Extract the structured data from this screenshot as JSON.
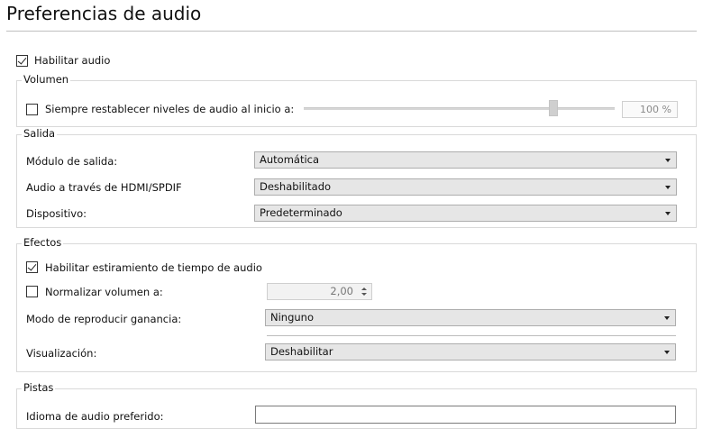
{
  "page": {
    "title": "Preferencias de audio"
  },
  "enable_audio": {
    "label": "Habilitar audio",
    "checked": true
  },
  "volume": {
    "group_label": "Volumen",
    "reset_label": "Siempre restablecer niveles de audio al inicio a:",
    "reset_checked": false,
    "percent_text": "100 %",
    "level": 100
  },
  "output": {
    "group_label": "Salida",
    "module_label": "Módulo de salida:",
    "module_value": "Automática",
    "hdmi_label": "Audio a través de HDMI/SPDIF",
    "hdmi_value": "Deshabilitado",
    "device_label": "Dispositivo:",
    "device_value": "Predeterminado"
  },
  "effects": {
    "group_label": "Efectos",
    "stretch_label": "Habilitar estiramiento de tiempo de audio",
    "stretch_checked": true,
    "normalize_label": "Normalizar volumen a:",
    "normalize_checked": false,
    "normalize_value": "2,00",
    "replay_gain_label": "Modo de reproducir ganancia:",
    "replay_gain_value": "Ninguno",
    "visualization_label": "Visualización:",
    "visualization_value": "Deshabilitar"
  },
  "tracks": {
    "group_label": "Pistas",
    "language_label": "Idioma de audio preferido:",
    "language_value": ""
  }
}
